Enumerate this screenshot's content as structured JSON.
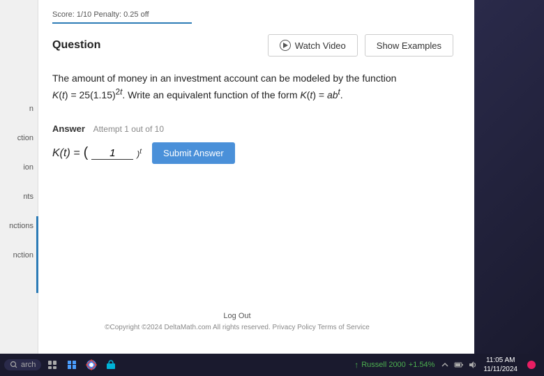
{
  "score_bar": {
    "text": "Score: 1/10    Penalty: 0.25 off"
  },
  "question_header": {
    "label": "Question",
    "watch_video_label": "Watch Video",
    "show_examples_label": "Show Examples"
  },
  "question": {
    "text_line1": "The amount of money in an investment account can be modeled by the function",
    "text_line2": "K(t) = 25(1.15)",
    "text_line2_exp": "2t",
    "text_line2_rest": ". Write an equivalent function of the form",
    "text_line2_form": "K(t) = ab",
    "text_line2_form_exp": "t",
    "text_line2_period": "."
  },
  "answer": {
    "label": "Answer",
    "attempt_text": "Attempt 1 out of 10",
    "kt_label": "K(t) =",
    "paren_left": "(",
    "input_placeholder": "1",
    "exponent": "t",
    "submit_label": "Submit Answer"
  },
  "sidebar_items": [
    {
      "label": "n"
    },
    {
      "label": "ction"
    },
    {
      "label": "ion"
    },
    {
      "label": "nts"
    },
    {
      "label": "nctions"
    },
    {
      "label": "nction"
    }
  ],
  "footer": {
    "log_out": "Log Out",
    "copyright": "©Copyright ©2024 DeltaMath.com All rights reserved.    Privacy Policy   Terms of Service"
  },
  "taskbar": {
    "search_placeholder": "arch",
    "stock_name": "Russell 2000",
    "stock_change": "+1.54%",
    "time": "11:05 AM",
    "date": "11/11/2024"
  }
}
